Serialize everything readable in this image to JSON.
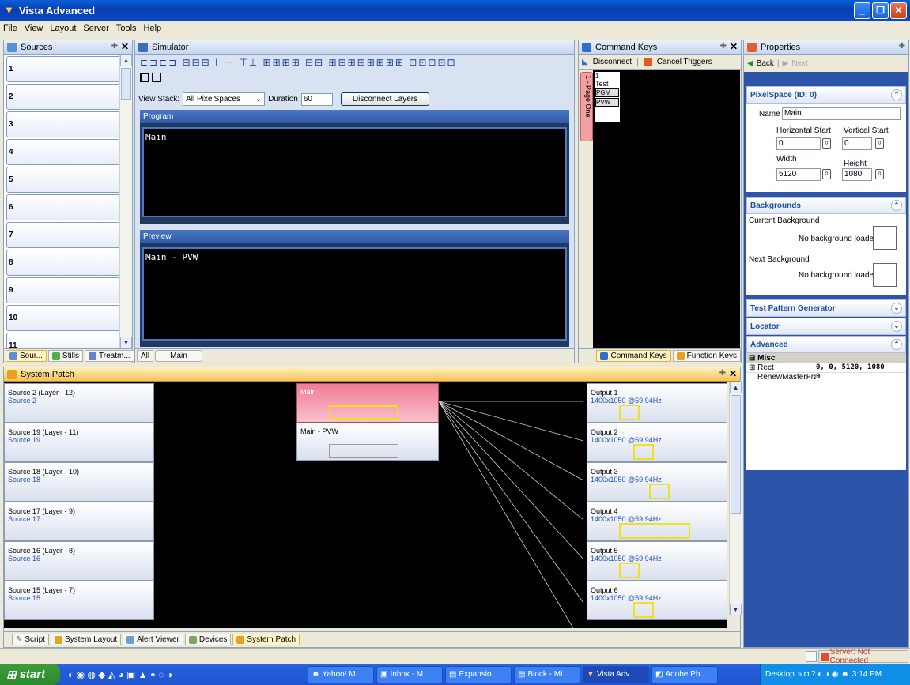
{
  "window": {
    "title": "Vista Advanced",
    "controls": [
      "_",
      "❐",
      "✕"
    ]
  },
  "menu": [
    "File",
    "View",
    "Layout",
    "Server",
    "Tools",
    "Help"
  ],
  "sources": {
    "title": "Sources",
    "items": [
      "1",
      "2",
      "3",
      "4",
      "5",
      "6",
      "7",
      "8",
      "9",
      "10",
      "11"
    ],
    "tabs": [
      "Sour...",
      "Stills",
      "Treatm..."
    ]
  },
  "simulator": {
    "title": "Simulator",
    "view_stack_label": "View Stack:",
    "view_stack_value": "All PixelSpaces",
    "duration_label": "Duration",
    "duration_value": "60",
    "disconnect_layers": "Disconnect Layers",
    "program_label": "Program",
    "program_text": "Main",
    "preview_label": "Preview",
    "preview_text": "Main - PVW",
    "bottom_tabs": [
      "All",
      "Main"
    ]
  },
  "command_keys": {
    "title": "Command Keys",
    "disconnect": "Disconnect",
    "cancel_triggers": "Cancel Triggers",
    "page_tab": "1 - Page One",
    "key_number": "1",
    "key_name": "Test",
    "pgm": "PGM",
    "pvw": "PVW",
    "bottom_tabs": [
      "Command Keys",
      "Function Keys"
    ]
  },
  "properties": {
    "title": "Properties",
    "back": "Back",
    "next": "Next",
    "pixelspace_title": "PixelSpace (ID: 0)",
    "name_label": "Name",
    "name_value": "Main",
    "hstart_label": "Horizontal Start",
    "hstart_value": "0",
    "vstart_label": "Vertical Start",
    "vstart_value": "0",
    "width_label": "Width",
    "width_value": "5120",
    "height_label": "Height",
    "height_value": "1080",
    "backgrounds_title": "Backgrounds",
    "current_bg_label": "Current Background",
    "current_bg_text": "No background loaded",
    "next_bg_label": "Next Background",
    "next_bg_text": "No background loaded",
    "test_pattern_title": "Test Pattern Generator",
    "locator_title": "Locator",
    "advanced_title": "Advanced",
    "misc_label": "Misc",
    "rect_label": "Rect",
    "rect_value": "0, 0, 5120, 1080",
    "renew_label": "RenewMasterFrar",
    "renew_value": "0"
  },
  "system_patch": {
    "title": "System Patch",
    "inputs": [
      {
        "name": "Source 2 (Layer - 12)",
        "sub": "Source 2"
      },
      {
        "name": "Source 19 (Layer - 11)",
        "sub": "Source 19"
      },
      {
        "name": "Source 18 (Layer - 10)",
        "sub": "Source 18"
      },
      {
        "name": "Source 17 (Layer - 9)",
        "sub": "Source 17"
      },
      {
        "name": "Source 16 (Layer - 8)",
        "sub": "Source 16"
      },
      {
        "name": "Source 15 (Layer - 7)",
        "sub": "Source 15"
      }
    ],
    "pixelspaces": [
      "Main",
      "Main - PVW"
    ],
    "outputs": [
      {
        "name": "Output 1",
        "res": "1400x1050 @59.94Hz"
      },
      {
        "name": "Output 2",
        "res": "1400x1050 @59.94Hz"
      },
      {
        "name": "Output 3",
        "res": "1400x1050 @59.94Hz"
      },
      {
        "name": "Output 4",
        "res": "1400x1050 @59.94Hz"
      },
      {
        "name": "Output 5",
        "res": "1400x1050 @59.94Hz"
      },
      {
        "name": "Output 6",
        "res": "1400x1050 @59.94Hz"
      }
    ]
  },
  "bottom_tabs": [
    "Script",
    "System Layout",
    "Alert Viewer",
    "Devices",
    "System Patch"
  ],
  "status": {
    "server": "Server: Not Connected"
  },
  "taskbar": {
    "start": "start",
    "items": [
      "Yahoo! M...",
      "Inbox - M...",
      "Expansio...",
      "Block - Mi...",
      "Vista Adv...",
      "Adobe Ph..."
    ],
    "desktop": "Desktop",
    "time": "3:14 PM"
  },
  "colors": {
    "accent": "#0a49c4",
    "program_node": "#f08aa0",
    "patch_bg": "#000000"
  }
}
